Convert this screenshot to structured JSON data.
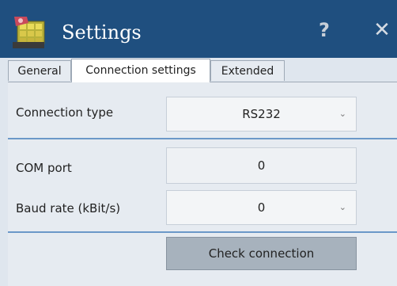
{
  "window": {
    "title": "Settings",
    "help_glyph": "?",
    "close_glyph": "✕",
    "app_icon": "settings-app-icon"
  },
  "tabs": [
    {
      "label": "General",
      "active": false
    },
    {
      "label": "Connection settings",
      "active": true
    },
    {
      "label": "Extended",
      "active": false
    }
  ],
  "connection": {
    "type_label": "Connection type",
    "type_value": "RS232",
    "com_port_label": "COM port",
    "com_port_value": "0",
    "baud_rate_label": "Baud rate (kBit/s)",
    "baud_rate_value": "0",
    "check_button_label": "Check connection"
  },
  "icons": {
    "dropdown": "chevron-down-icon",
    "help": "help-icon",
    "close": "close-icon"
  },
  "colors": {
    "titlebar": "#1f4f7f",
    "panel": "#e6ebf1",
    "separator": "#6b98c8",
    "button": "#a7b2bd"
  }
}
